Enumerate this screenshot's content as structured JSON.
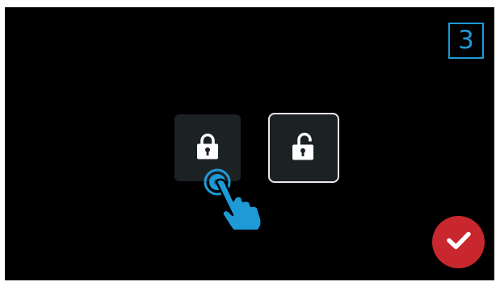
{
  "step": {
    "number": "3",
    "color": "#1e9bd7"
  },
  "lock_options": [
    {
      "state": "locked",
      "icon": "padlock-closed-icon",
      "selected": false
    },
    {
      "state": "unlocked",
      "icon": "padlock-open-icon",
      "selected": true
    }
  ],
  "gesture": {
    "icon": "tap-hand-icon",
    "color": "#1e9bd7",
    "target": "locked"
  },
  "confirm": {
    "icon": "checkmark-icon",
    "color": "#c8272d"
  },
  "colors": {
    "background": "#000000",
    "tile": "#1c2124",
    "selected_border": "#e8eaeb",
    "icon": "#ffffff"
  }
}
